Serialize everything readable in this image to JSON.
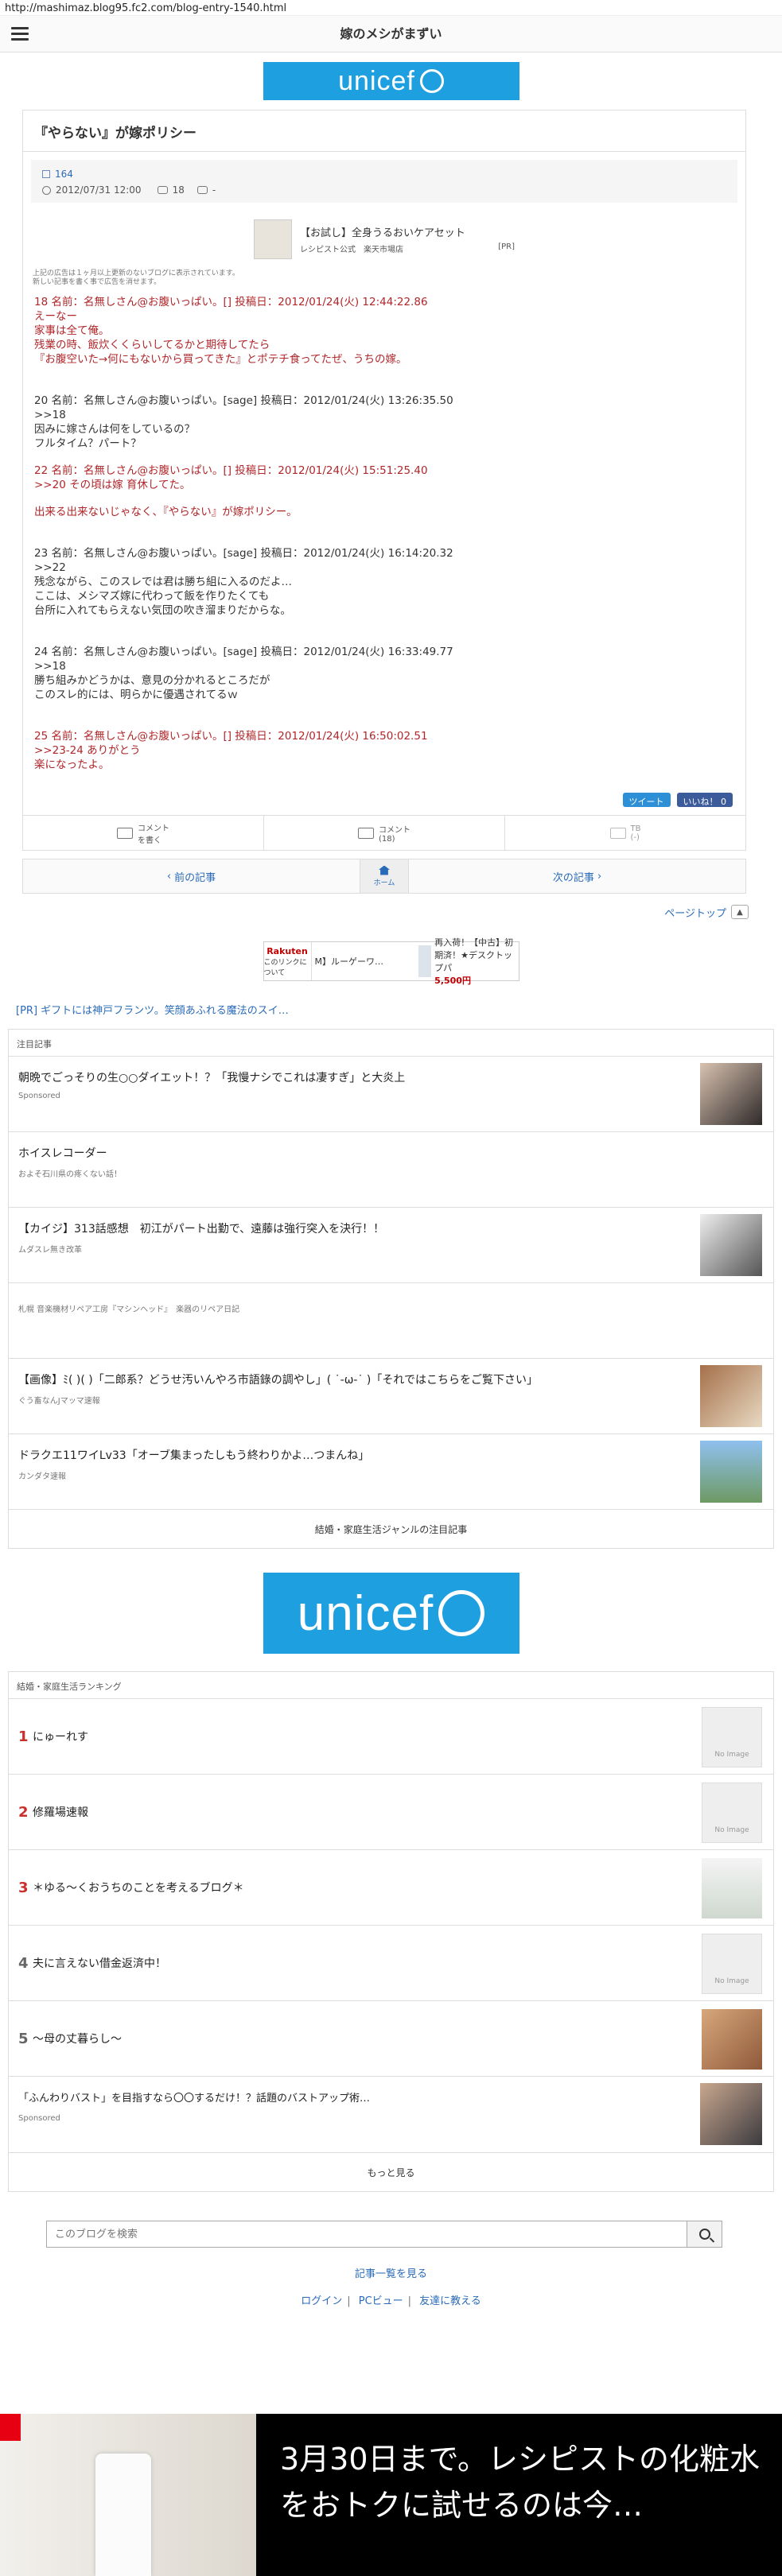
{
  "url": "http://mashimaz.blog95.fc2.com/blog-entry-1540.html",
  "site_title": "嫁のメシがまずい",
  "unicef": "unicef",
  "article": {
    "title": "『やらない』が嫁ポリシー",
    "category": "164",
    "date": "2012/07/31 12:00",
    "comments": "18",
    "trackbacks": "-"
  },
  "ad": {
    "title": "【お試し】全身うるおいケアセット",
    "sponsor": "レシピスト公式　楽天市場店",
    "pr": "[PR]"
  },
  "notice": "上記の広告は１ヶ月以上更新のないブログに表示されています。\n新しい記事を書く事で広告を消せます。",
  "posts": [
    {
      "cls": "red",
      "text": "18 名前：名無しさん@お腹いっぱい。[] 投稿日：2012/01/24(火) 12:44:22.86\nえーなー\n家事は全て俺。\n残業の時、飯炊くくらいしてるかと期待してたら\n『お腹空いた→何にもないから買ってきた』とポテチ食ってたぜ、うちの嫁。"
    },
    {
      "cls": "dark",
      "text": "\n20 名前：名無しさん@お腹いっぱい。[sage] 投稿日：2012/01/24(火) 13:26:35.50\n>>18\n因みに嫁さんは何をしているの？\nフルタイム？パート？"
    },
    {
      "cls": "red",
      "text": "22 名前：名無しさん@お腹いっぱい。[] 投稿日：2012/01/24(火) 15:51:25.40\n>>20 その頃は嫁 育休してた。"
    },
    {
      "cls": "red",
      "text": "出来る出来ないじゃなく、『やらない』が嫁ポリシー。"
    },
    {
      "cls": "dark",
      "text": "\n23 名前：名無しさん@お腹いっぱい。[sage] 投稿日：2012/01/24(火) 16:14:20.32\n>>22\n残念ながら、このスレでは君は勝ち組に入るのだよ…\nここは、メシマズ嫁に代わって飯を作りたくても\n台所に入れてもらえない気団の吹き溜まりだからな。"
    },
    {
      "cls": "dark",
      "text": "\n24 名前：名無しさん@お腹いっぱい。[sage] 投稿日：2012/01/24(火) 16:33:49.77\n>>18\n勝ち組みかどうかは、意見の分かれるところだが\nこのスレ的には、明らかに優遇されてるｗ"
    },
    {
      "cls": "red",
      "text": "\n25 名前：名無しさん@お腹いっぱい。[] 投稿日：2012/01/24(火) 16:50:02.51\n>>23-24 ありがとう\n楽になったよ。"
    }
  ],
  "share": {
    "tweet": "ツイート",
    "like": "いいね！ 0"
  },
  "actions": [
    {
      "label": "コメント\nを書く"
    },
    {
      "label": "コメント\n(18)"
    },
    {
      "label": "TB\n(-)"
    }
  ],
  "pager": {
    "prev": "前の記事",
    "home": "ホーム",
    "next": "次の記事"
  },
  "page_top": "ページトップ",
  "rakuten": {
    "logo": "Rakuten",
    "logo_sub": "このリンクについて",
    "item1": "M】ルーゲーワ…",
    "item2": "再入荷！【中古】初期済！★デスクトップパ",
    "price": "5,500円"
  },
  "pr_link": "[PR] ギフトには神戸フランツ。笑顔あふれる魔法のスイ…",
  "featured": {
    "heading": "注目記事",
    "items": [
      {
        "title": "朝晩でごっそりの生○○ダイエット！？「我慢ナシでこれは凄すぎ」と大炎上",
        "source": "Sponsored"
      },
      {
        "title": "ホイスレコーダー",
        "source": "およそ石川県の疼くない話！"
      },
      {
        "title": "【カイジ】313話感想　初江がパート出勤で、遠藤は強行突入を決行！！",
        "source": "ムダスレ無き改革"
      },
      {
        "title": "",
        "source": "札幌 音楽機材リペア工房『マシンヘッド』　楽器のリペア日記"
      },
      {
        "title": "【画像】ﾐ( )( )「二郎系？どうせ汚いんやろ市語錄の調やし」( ˙-ω-˙ )「それではこちらをご覧下さい」",
        "source": "ぐう畜なんJマッマ速報"
      },
      {
        "title": "ドラクエ11ワイLv33「オーブ集まったしもう終わりかよ…つまんね」",
        "source": "カンダタ速報"
      }
    ],
    "footer": "結婚・家庭生活ジャンルの注目記事"
  },
  "ranking": {
    "heading": "結婚・家庭生活ランキング",
    "items": [
      {
        "num": "1",
        "title": "にゅーれす",
        "img": "No Image"
      },
      {
        "num": "2",
        "title": "修羅場速報",
        "img": "No Image"
      },
      {
        "num": "3",
        "title": "＊ゆる～くおうちのことを考えるブログ＊",
        "img": ""
      },
      {
        "num": "4",
        "title": "夫に言えない借金返済中！",
        "img": "No Image"
      },
      {
        "num": "5",
        "title": "～母の丈暮らし～",
        "img": ""
      }
    ],
    "sponsored": {
      "title": "「ふんわりバスト」を目指すなら〇〇するだけ！？話題のバストアップ術…",
      "source": "Sponsored"
    },
    "more": "もっと見る"
  },
  "search": {
    "placeholder": "このブログを検索"
  },
  "footer": {
    "list_link": "記事一覧を見る",
    "login": "ログイン",
    "pc": "PCビュー",
    "friends": "友達に教える"
  },
  "bottom_ad": {
    "text": "3月30日まで。レシピストの化粧水をおトクに試せるのは今…"
  },
  "colors": {
    "red_text": "#b0262a",
    "unicef_blue": "#1e9fe0",
    "link": "#2a6bb8"
  }
}
